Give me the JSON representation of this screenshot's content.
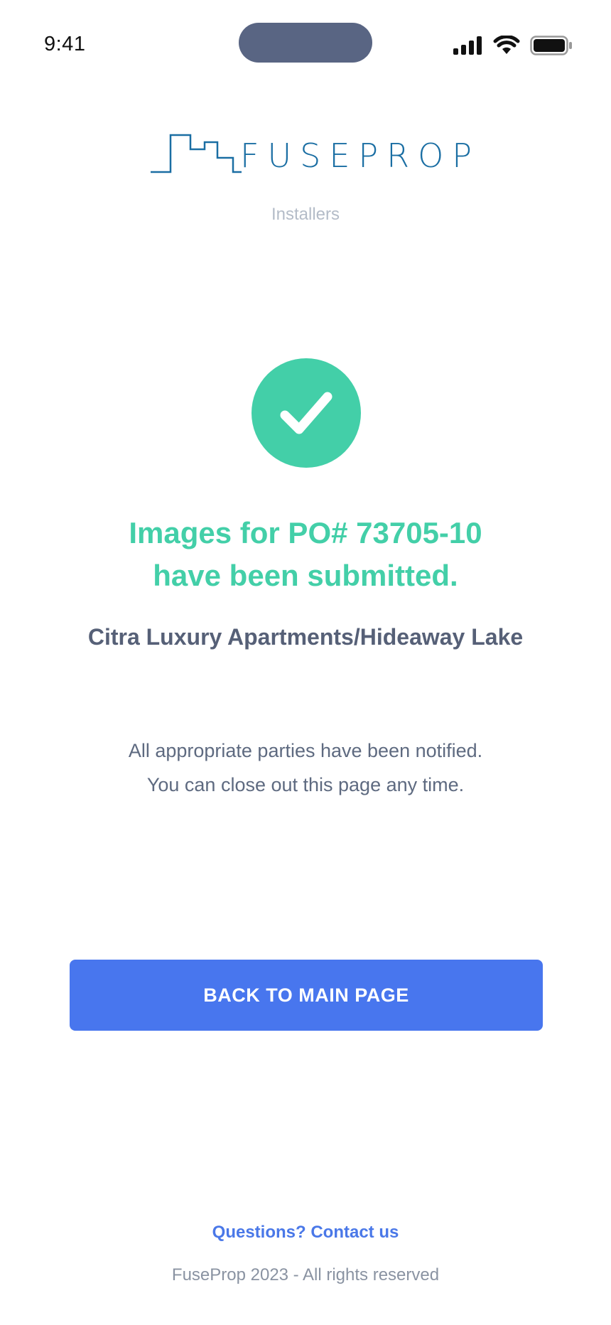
{
  "status_bar": {
    "time": "9:41",
    "icons": [
      "signal-icon",
      "wifi-icon",
      "battery-icon"
    ]
  },
  "brand": {
    "name": "FUSEPROP",
    "subtitle": "Installers",
    "logo_color": "#1a6ea3"
  },
  "success": {
    "icon": "checkmark-icon",
    "icon_color": "#43cfa8",
    "headline_line1": "Images for PO# 73705-10",
    "headline_line2": "have been submitted.",
    "property_name": "Citra Luxury Apartments/Hideaway Lake",
    "message_line1": "All appropriate parties have been notified.",
    "message_line2": "You can close out this page any time."
  },
  "actions": {
    "back_button_label": "BACK TO MAIN PAGE",
    "button_color": "#4876ee"
  },
  "footer": {
    "contact_label": "Questions? Contact us",
    "copyright": "FuseProp 2023 - All rights reserved"
  }
}
